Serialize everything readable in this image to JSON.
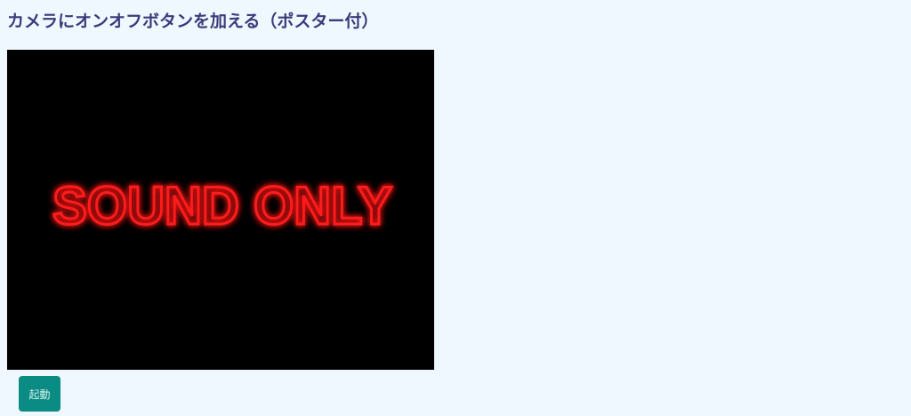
{
  "page": {
    "title": "カメラにオンオフボタンを加える（ポスター付）"
  },
  "video": {
    "poster_text": "SOUND ONLY",
    "poster_text_color": "#ff1a1a",
    "background_color": "#000000"
  },
  "controls": {
    "start_label": "起動",
    "button_color": "#0a8c84"
  }
}
